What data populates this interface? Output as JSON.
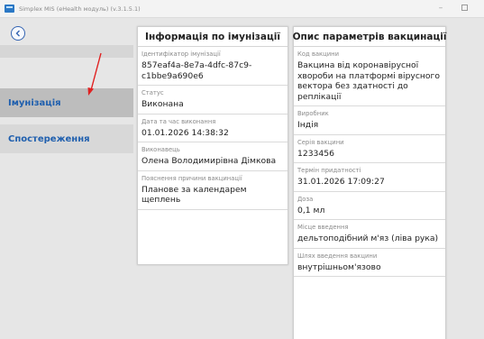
{
  "window": {
    "title": "Simplex MIS (eHealth модуль) (v.3.1.5.1)",
    "minimize_glyph": "–"
  },
  "nav": {
    "back_icon": "back-arrow-icon",
    "items": [
      {
        "label": "Імунізація",
        "active": true
      },
      {
        "label": "Спостереження",
        "active": false
      }
    ],
    "accent_color": "#1f5fae"
  },
  "immunization_card": {
    "title": "Інформація по імунізації",
    "fields": [
      {
        "label": "Ідентифікатор імунізації",
        "value": "857eaf4a-8e7a-4dfc-87c9-c1bbe9a690e6"
      },
      {
        "label": "Статус",
        "value": "Виконана"
      },
      {
        "label": "Дата та час виконання",
        "value": "01.01.2026 14:38:32"
      },
      {
        "label": "Виконавець",
        "value": "Олена Володимирівна Дімкова"
      },
      {
        "label": "Пояснення причини вакцинації",
        "value": "Планове за календарем щеплень"
      }
    ]
  },
  "vaccination_card": {
    "title": "Опис параметрів вакцинації",
    "fields": [
      {
        "label": "Код вакцини",
        "value": "Вакцина від коронавірусної хвороби на платформі вірусного вектора без здатності до реплікації"
      },
      {
        "label": "Виробник",
        "value": "Індія"
      },
      {
        "label": "Серія вакцини",
        "value": "1233456"
      },
      {
        "label": "Термін придатності",
        "value": "31.01.2026 17:09:27"
      },
      {
        "label": "Доза",
        "value": "0,1 мл"
      },
      {
        "label": "Місце введення",
        "value": "дельтоподібний м'яз (ліва рука)"
      },
      {
        "label": "Шлях введення вакцини",
        "value": "внутрішньом'язово"
      }
    ]
  }
}
